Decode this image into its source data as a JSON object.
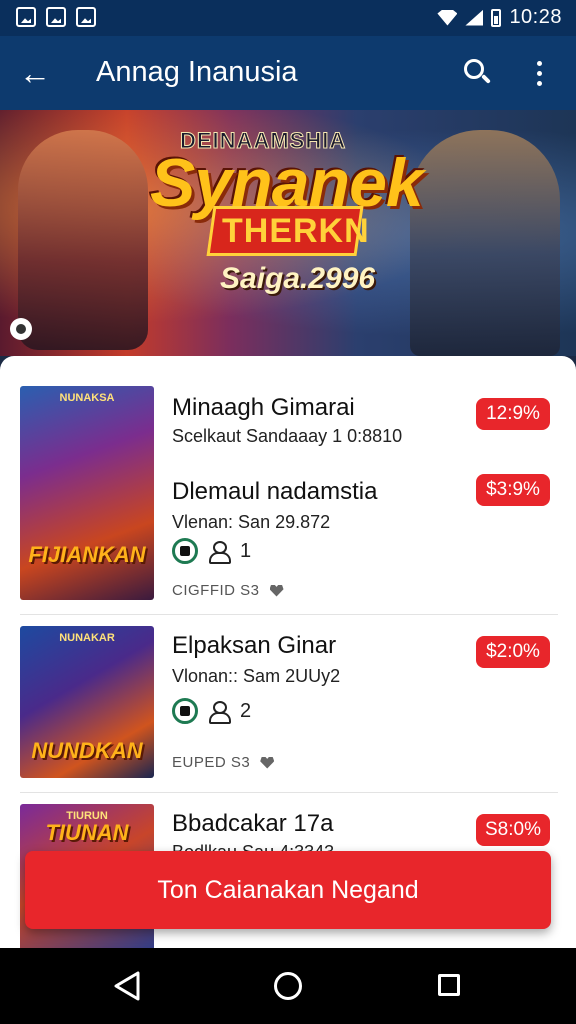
{
  "status_bar": {
    "time": "10:28",
    "icons": [
      "gallery-icon",
      "image-icon",
      "notification-icon",
      "wifi-icon",
      "signal-icon",
      "battery-icon"
    ]
  },
  "app_bar": {
    "title": "Annag Inanusia",
    "back_icon": "arrow-left",
    "search_icon": "search",
    "more_icon": "more-vertical"
  },
  "hero": {
    "kicker": "DEINAAMSHIA",
    "title": "Synanek",
    "ribbon": "THERKN",
    "subtitle": "Saiga.2996"
  },
  "items": [
    {
      "cover_title": "FIJIANKAN",
      "cover_top": "NUNAKSA",
      "title": "Minaagh Gimarai",
      "subtitle": "Scelkaut Sandaaay 1 0:8810",
      "price": "12:9%",
      "title2": "Dlemaul nadamstia",
      "subtitle2": "Vlenan: San 29.872",
      "count": "1",
      "footer": "CIGFFID S3"
    },
    {
      "cover_title": "NUNDKAN",
      "cover_top": "NUNAKAR",
      "title": "Elpaksan Ginar",
      "subtitle": "Vlonan:: Sam 2UUy2",
      "price": "$2:0%",
      "count": "2",
      "footer": "EUPED S3"
    },
    {
      "cover_title": "TIUNAN",
      "cover_top": "TIURUN",
      "title": "Bbadcakar 17a",
      "subtitle": "Bodlkau Sau 4:3343",
      "price": "S8:0%"
    }
  ],
  "cta": {
    "label": "Ton Caianakan Negand"
  },
  "colors": {
    "app_bar": "#0d3a6e",
    "status_bar": "#0a2f5c",
    "accent_red": "#e8262b",
    "rating_green": "#1e7a52"
  },
  "nav": {
    "back_icon": "triangle-back",
    "home_icon": "circle-home",
    "recents_icon": "square-recents"
  }
}
